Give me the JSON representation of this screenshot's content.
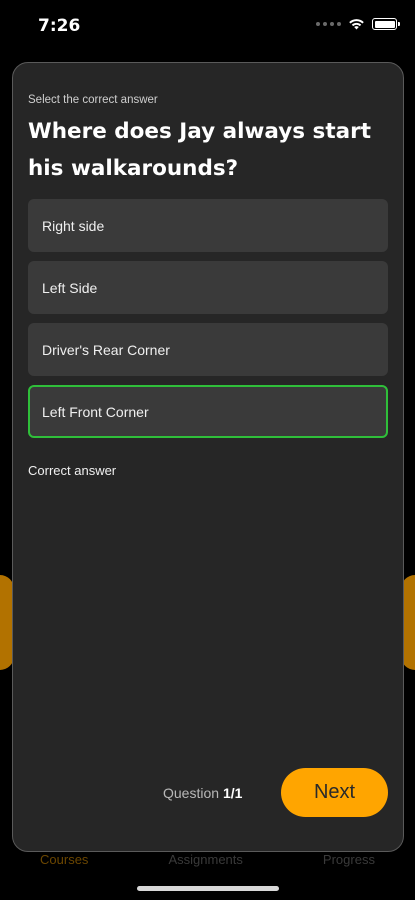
{
  "status_bar": {
    "time": "7:26"
  },
  "quiz": {
    "prompt": "Select the correct answer",
    "question": "Where does Jay always start his walkarounds?",
    "options": [
      {
        "label": "Right side",
        "state": "default"
      },
      {
        "label": "Left Side",
        "state": "default"
      },
      {
        "label": "Driver's Rear Corner",
        "state": "default"
      },
      {
        "label": "Left Front Corner",
        "state": "correct"
      }
    ],
    "feedback": "Correct answer",
    "counter_label": "Question",
    "counter_value": "1/1",
    "next_label": "Next"
  },
  "colors": {
    "accent": "#ffa500",
    "correct_border": "#2fbf3a",
    "sheet_bg": "#262626",
    "option_bg": "#3a3a3a"
  },
  "tabbar": {
    "tabs": [
      {
        "label": "Courses",
        "active": true
      },
      {
        "label": "Assignments",
        "active": false
      },
      {
        "label": "Progress",
        "active": false
      }
    ]
  }
}
